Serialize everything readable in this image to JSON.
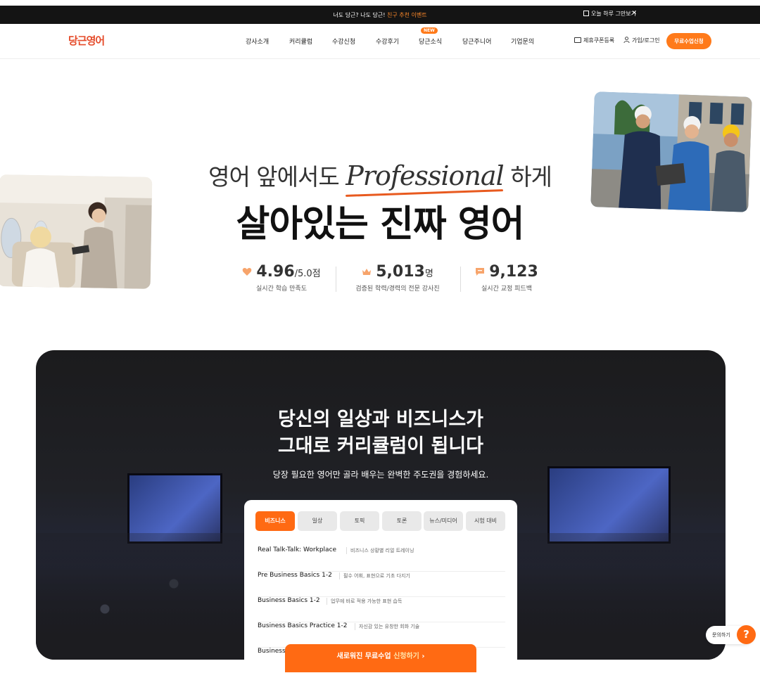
{
  "topbar": {
    "promo_prefix": "너도 당근? 나도 당근! ",
    "promo_highlight": "친구 추천 이벤트",
    "dismiss_label": "오늘 하루 그만보기",
    "close_glyph": "✕"
  },
  "nav": {
    "logo": "당근영어",
    "items": [
      "강사소개",
      "커리큘럼",
      "수강신청",
      "수강후기",
      "당근소식",
      "당근주니어",
      "기업문의"
    ],
    "new_badge": "NEW",
    "coupon_label": "제휴쿠폰등록",
    "login_label": "가입/로그인",
    "cta_label": "무료수업신청"
  },
  "hero": {
    "line1_prefix": "영어 앞에서도 ",
    "line1_script": "Professional",
    "line1_suffix": " 하게",
    "line2": "살아있는 진짜 영어"
  },
  "stats": [
    {
      "value": "4.96",
      "unit": "/5.0점",
      "label": "실시간 학습 만족도",
      "icon": "heart-icon"
    },
    {
      "value": "5,013",
      "unit": "명",
      "label": "검증된 학력/경력의 전문 강사진",
      "icon": "crown-icon"
    },
    {
      "value": "9,123",
      "unit": "",
      "label": "실시간 교정 피드백",
      "icon": "chat-icon"
    }
  ],
  "curriculum": {
    "title_line1": "당신의 일상과 비즈니스가",
    "title_line2": "그대로 커리큘럼이 됩니다",
    "subtitle": "당장 필요한 영어만 골라 배우는 완벽한 주도권을 경험하세요.",
    "tabs": [
      "비즈니스",
      "일상",
      "토픽",
      "토론",
      "뉴스/미디어",
      "시험 대비"
    ],
    "active_tab": "비즈니스",
    "courses": [
      {
        "title": "Real Talk-Talk: Workplace",
        "desc": "비즈니스 상황별 리얼 트레이닝"
      },
      {
        "title": "Pre Business Basics 1-2",
        "desc": "필수 어휘, 표현으로 기초 다지기"
      },
      {
        "title": "Business Basics 1-2",
        "desc": "업무에 바로 적용 가능한 표현 습득"
      },
      {
        "title": "Business Basics Practice 1-2",
        "desc": "자신감 있는 유창한 회화 기술"
      },
      {
        "title": "Business",
        "desc": ""
      }
    ]
  },
  "bottom_cta": {
    "prefix": "새로워진 무료수업 ",
    "highlight": "신청하기",
    "arrow": "›"
  },
  "help": {
    "label": "문의하기",
    "glyph": "?"
  },
  "colors": {
    "accent": "#ff6a13",
    "logo": "#e54b2a",
    "topbar": "#141414"
  }
}
